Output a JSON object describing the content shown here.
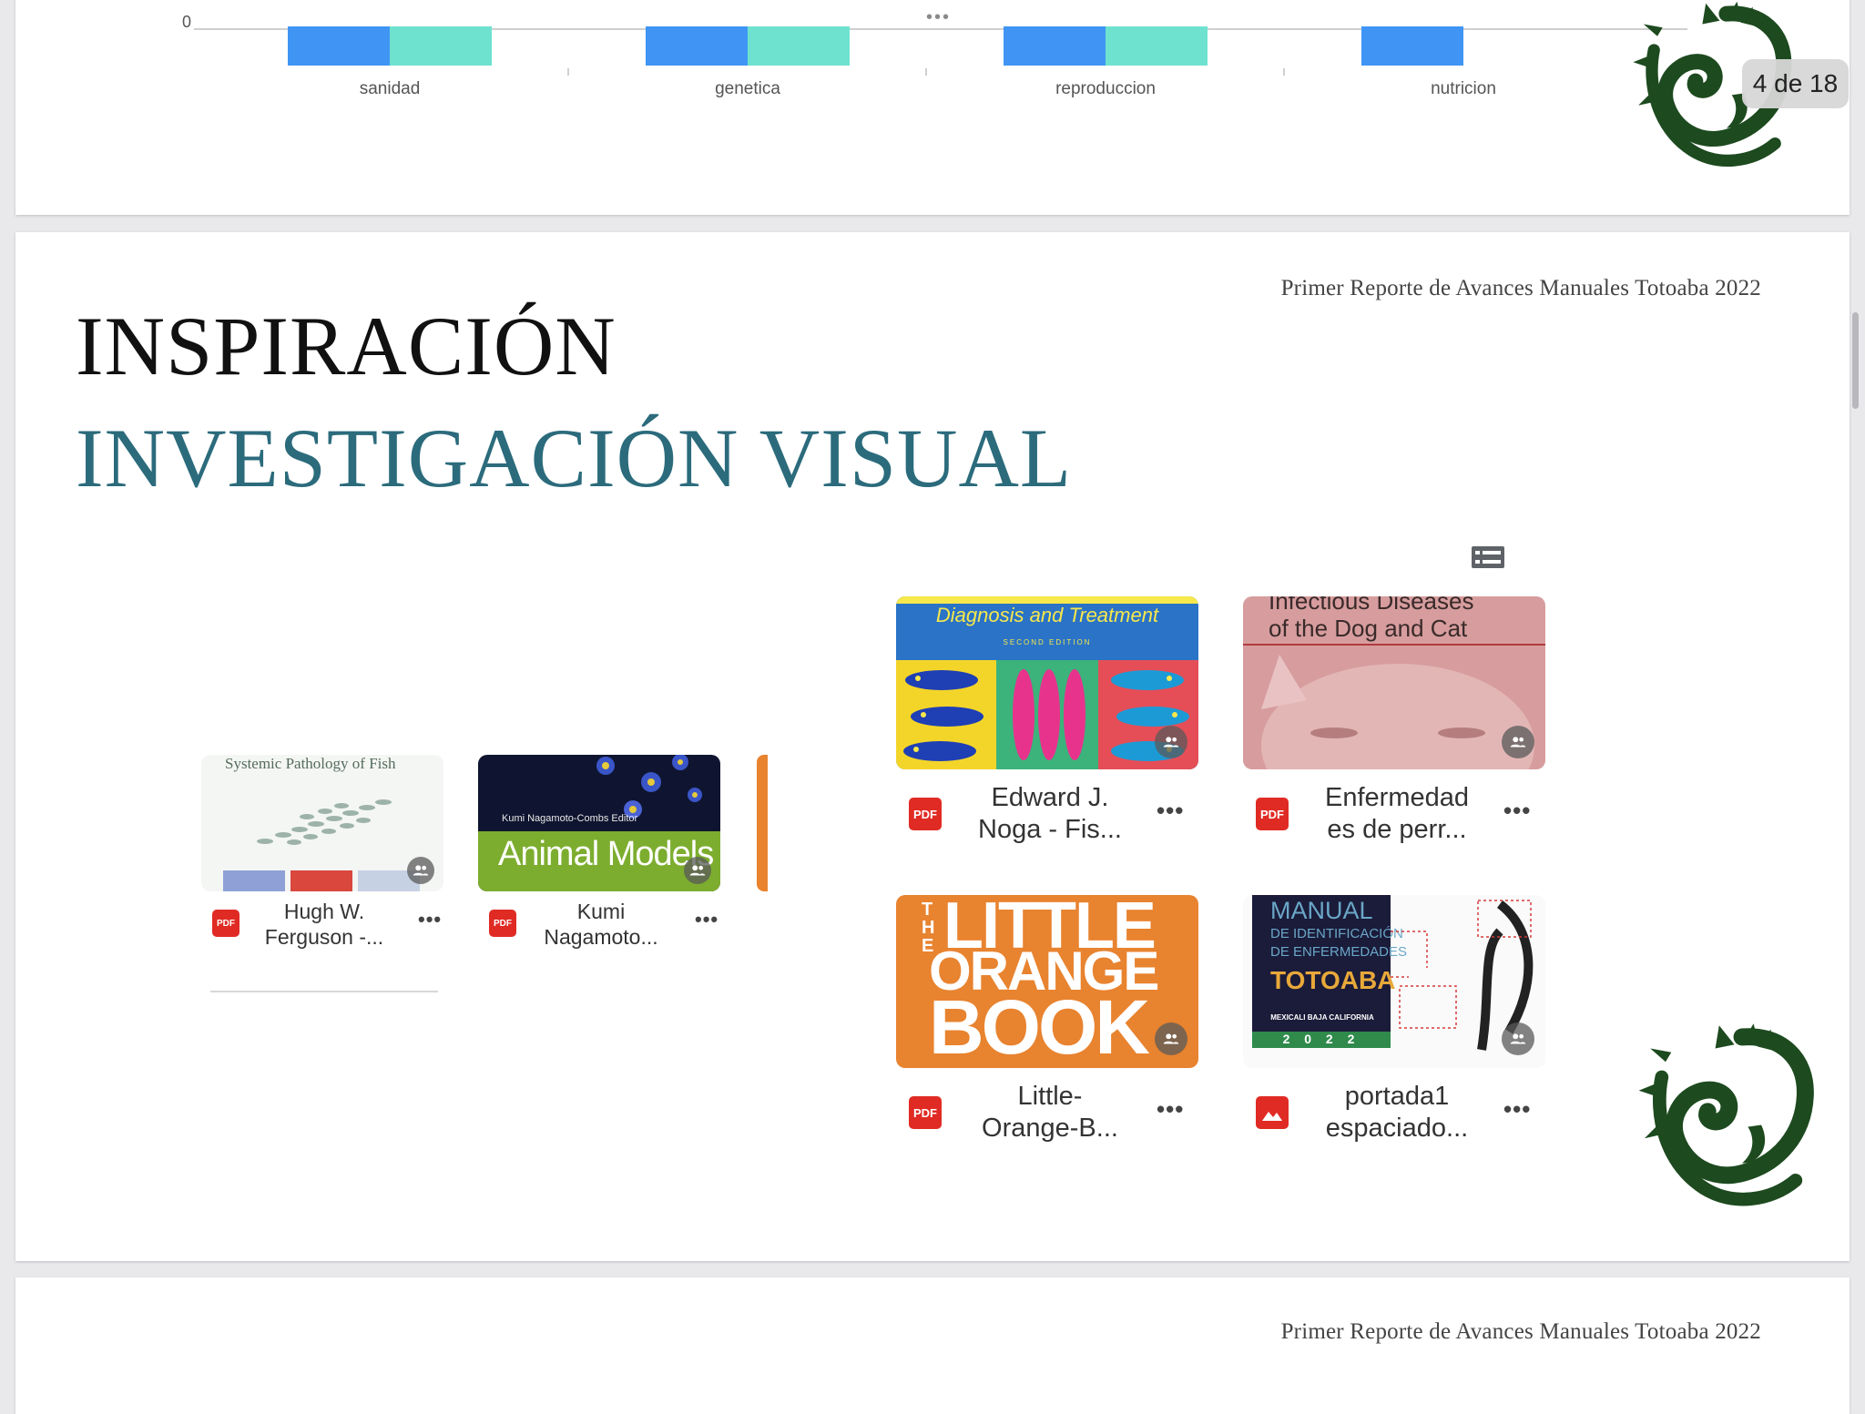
{
  "chart_data": {
    "type": "bar",
    "categories": [
      "sanidad",
      "genetica",
      "reproduccion",
      "nutricion"
    ],
    "y_tick_labels": [
      "0"
    ],
    "series_colors": [
      "#4095f4",
      "#6ee2cf"
    ],
    "more_indicator": "•••"
  },
  "slide": {
    "header": "Primer Reporte de Avances Manuales Totoaba 2022",
    "title_line1": "INSPIRACIÓN",
    "title_line2": "INVESTIGACIÓN VISUAL"
  },
  "embed_left": {
    "files": [
      {
        "type_label": "PDF",
        "name_line1": "Hugh W.",
        "name_line2": "Ferguson -...",
        "thumb_text": "Systemic Pathology of Fish"
      },
      {
        "type_label": "PDF",
        "name_line1": "Kumi",
        "name_line2": "Nagamoto...",
        "thumb_editor": "Kumi Nagamoto-Combs  Editor",
        "thumb_title": "Animal Models"
      }
    ]
  },
  "embed_right": {
    "files": [
      {
        "type_label": "PDF",
        "name_line1": "Edward J.",
        "name_line2": "Noga - Fis...",
        "thumb_title": "Diagnosis and Treatment",
        "thumb_subtitle": "SECOND EDITION"
      },
      {
        "type_label": "PDF",
        "name_line1": "Enfermedad",
        "name_line2": "es de perr...",
        "thumb_line1": "Infectious Diseases",
        "thumb_line2": "of the Dog and Cat"
      },
      {
        "type_label": "PDF",
        "name_line1": "Little-",
        "name_line2": "Orange-B...",
        "thumb_the": "THE",
        "thumb_l1": "LITTLE",
        "thumb_l2": "ORANGE",
        "thumb_l3": "BOOK"
      },
      {
        "type_label": "image",
        "name_line1": "portada1",
        "name_line2": "espaciado...",
        "thumb_l1": "MANUAL",
        "thumb_l2": "DE IDENTIFICACIÓN",
        "thumb_l3": "DE ENFERMEDADES",
        "thumb_l4": "TOTOABA",
        "thumb_l5": "MEXICALI BAJA CALIFORNIA",
        "thumb_l6": "2 0 2 2"
      }
    ]
  },
  "more_label": "•••",
  "page_counter": "4 de 18",
  "next_slide": {
    "header": "Primer Reporte de Avances Manuales Totoaba 2022"
  },
  "colors": {
    "title_teal": "#2b6b7c",
    "dragon_green": "#1d4a1f",
    "pdf_red": "#e02b24"
  }
}
